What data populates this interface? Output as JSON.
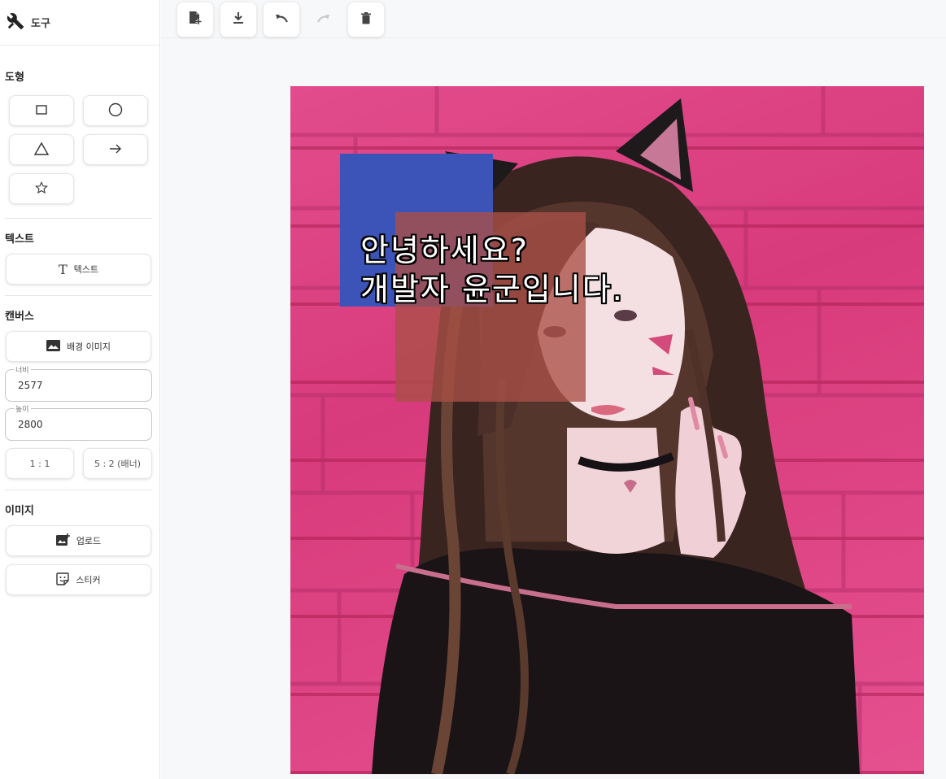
{
  "sidebar": {
    "header_title": "도구",
    "sections": {
      "shapes": "도형",
      "text": "텍스트",
      "canvas": "캔버스",
      "image": "이미지"
    },
    "text_button": "텍스트",
    "bg_image_button": "배경 이미지",
    "width_label": "너비",
    "width_value": "2577",
    "height_label": "높이",
    "height_value": "2800",
    "ratio_1_1": "1 : 1",
    "ratio_5_2": "5 : 2 (배너)",
    "upload_button": "업로드",
    "sticker_button": "스티커"
  },
  "toolbar": {
    "icons": [
      "new-file-icon",
      "download-icon",
      "undo-icon",
      "redo-icon",
      "delete-icon"
    ]
  },
  "canvas": {
    "text_line1": "안녕하세요?",
    "text_line2": "개발자 윤군입니다.",
    "colors": {
      "background": "#e24c8c",
      "blue_shape": "#3c54b8",
      "brown_shape": "#aa5046"
    }
  }
}
